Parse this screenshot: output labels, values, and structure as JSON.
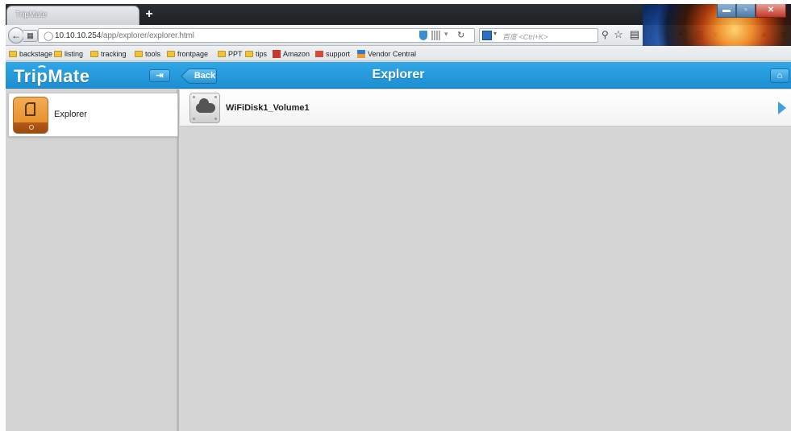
{
  "browser": {
    "tab_title": "TripMate",
    "new_tab_symbol": "+",
    "url_host": "10.10.10.254",
    "url_path": "/app/explorer/explorer.html",
    "search_placeholder": "百度 <Ctrl+K>",
    "window_controls": [
      "▬",
      "▫",
      "✕"
    ],
    "bookmarks": [
      {
        "label": "backstage",
        "icon": "folder-icon"
      },
      {
        "label": "listing",
        "icon": "folder-icon"
      },
      {
        "label": "tracking",
        "icon": "folder-icon"
      },
      {
        "label": "tools",
        "icon": "folder-icon"
      },
      {
        "label": "frontpage",
        "icon": "folder-icon"
      },
      {
        "label": "PPT",
        "icon": "folder-icon"
      },
      {
        "label": "tips",
        "icon": "folder-icon"
      },
      {
        "label": "Amazon",
        "icon": "amazon-icon"
      },
      {
        "label": "support",
        "icon": "mail-icon"
      },
      {
        "label": "Vendor Central",
        "icon": "vendor-central-icon"
      }
    ]
  },
  "app": {
    "logo": "TripMate",
    "collapse_symbol": "⇥",
    "back_label": "Back",
    "page_title": "Explorer",
    "home_symbol": "⌂",
    "accent_color": "#2298da"
  },
  "sidebar": {
    "items": [
      {
        "label": "Explorer",
        "icon": "explorer-sd-icon"
      }
    ]
  },
  "main": {
    "volumes": [
      {
        "label": "WiFiDisk1_Volume1",
        "icon": "cloud-disk-icon"
      }
    ]
  }
}
